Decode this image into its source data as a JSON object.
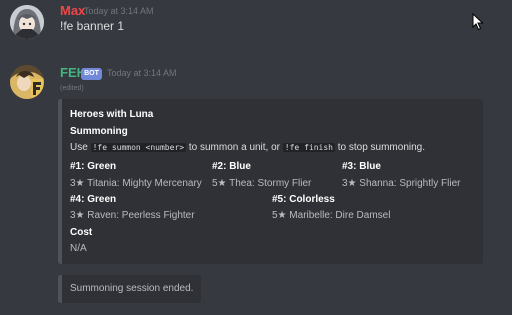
{
  "colors": {
    "background": "#36393f",
    "embed_bg": "#2f3136",
    "embed_border": "#4f545c",
    "max_name": "#f04747",
    "feh_name": "#43b581",
    "bot_badge": "#7289da"
  },
  "messages": [
    {
      "username": "Max",
      "timestamp": "Today at 3:14 AM",
      "text": "!fe banner 1",
      "avatar_icon": "anime-girl-avatar-icon"
    },
    {
      "username": "FEH",
      "badge": "BOT",
      "timestamp": "Today at 3:14 AM",
      "edited": "(edited)",
      "avatar_icon": "feh-bot-avatar-icon",
      "embed": {
        "title": "Heroes with Luna",
        "section_title": "Summoning",
        "instructions": {
          "before": "Use ",
          "code1": "!fe summon <number>",
          "middle": " to summon a unit, or ",
          "code2": "!fe finish",
          "after": " to stop summoning."
        },
        "fields": [
          {
            "name": "#1: Green",
            "value": "3★ Titania: Mighty Mercenary"
          },
          {
            "name": "#2: Blue",
            "value": "5★ Thea: Stormy Flier"
          },
          {
            "name": "#3: Blue",
            "value": "3★ Shanna: Sprightly Flier"
          },
          {
            "name": "#4: Green",
            "value": "3★ Raven: Peerless Fighter"
          },
          {
            "name": "#5: Colorless",
            "value": "5★ Maribelle: Dire Damsel"
          }
        ],
        "cost_label": "Cost",
        "cost_value": "N/A"
      }
    },
    {
      "embed_text": "Summoning session ended."
    }
  ]
}
